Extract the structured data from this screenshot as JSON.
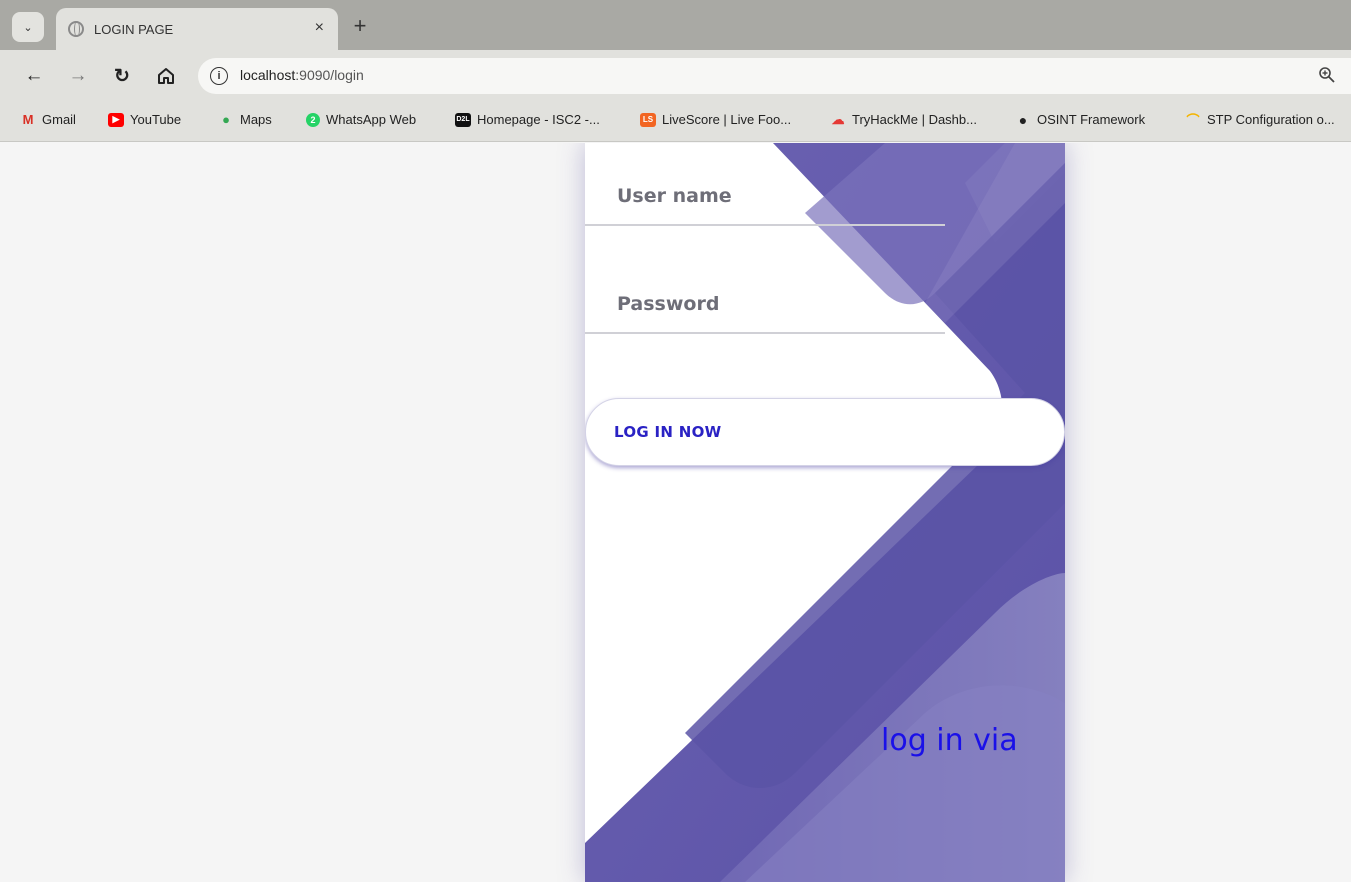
{
  "browser": {
    "tab_title": "LOGIN PAGE",
    "tab_close": "×",
    "new_tab": "+",
    "url_host": "localhost",
    "url_path": ":9090/login",
    "bookmarks": [
      {
        "label": "Gmail",
        "icon": "gmail-icon",
        "icon_text": "M",
        "color": "#d93025"
      },
      {
        "label": "YouTube",
        "icon": "youtube-icon",
        "icon_text": "▶",
        "color": "#ff0000"
      },
      {
        "label": "Maps",
        "icon": "maps-icon",
        "icon_text": "●",
        "color": "#34a853"
      },
      {
        "label": "WhatsApp Web",
        "icon": "whatsapp-icon",
        "icon_text": "2",
        "color": "#25d366"
      },
      {
        "label": "Homepage - ISC2 -...",
        "icon": "d2l-icon",
        "icon_text": "D2L",
        "color": "#111111"
      },
      {
        "label": "LiveScore | Live Foo...",
        "icon": "livescore-icon",
        "icon_text": "LS",
        "color": "#f26522"
      },
      {
        "label": "TryHackMe | Dashb...",
        "icon": "tryhackme-icon",
        "icon_text": "☁",
        "color": "#e53935"
      },
      {
        "label": "OSINT Framework",
        "icon": "osint-icon",
        "icon_text": "●",
        "color": "#222222"
      },
      {
        "label": "STP Configuration o...",
        "icon": "stp-icon",
        "icon_text": "⌒",
        "color": "#f4b400"
      }
    ]
  },
  "login": {
    "username_label": "User name",
    "password_label": "Password",
    "submit_label": "LOG IN NOW",
    "social_title": "log in via"
  },
  "colors": {
    "accent": "#6a5fb0",
    "button_text": "#2a22c4",
    "social_text": "#1a10e8"
  }
}
